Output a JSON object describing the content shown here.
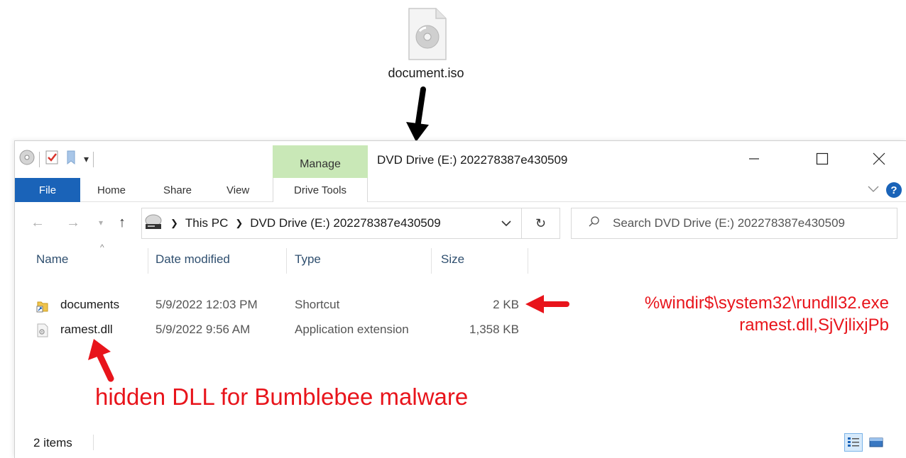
{
  "desktop": {
    "icon": "disc-image-file-icon",
    "label": "document.iso"
  },
  "window": {
    "context_tab": "Manage",
    "title": "DVD Drive (E:) 202278387e430509",
    "ribbon_tabs": [
      "File",
      "Home",
      "Share",
      "View",
      "Drive Tools"
    ]
  },
  "address": {
    "crumbs": [
      "This PC",
      "DVD Drive (E:) 202278387e430509"
    ]
  },
  "search": {
    "placeholder": "Search DVD Drive (E:) 202278387e430509"
  },
  "columns": {
    "name": "Name",
    "date": "Date modified",
    "type": "Type",
    "size": "Size"
  },
  "files": [
    {
      "name": "documents",
      "date": "5/9/2022 12:03 PM",
      "type": "Shortcut",
      "size": "2 KB",
      "icon": "shortcut-icon"
    },
    {
      "name": "ramest.dll",
      "date": "5/9/2022 9:56 AM",
      "type": "Application extension",
      "size": "1,358 KB",
      "icon": "dll-file-icon"
    }
  ],
  "status": {
    "count": "2 items"
  },
  "annotations": {
    "shortcut_target_line1": "%windir$\\system32\\rundll32.exe",
    "shortcut_target_line2": "ramest.dll,SjVjlixjPb",
    "dll_note": "hidden DLL for Bumblebee malware",
    "color": "#e8141b"
  }
}
